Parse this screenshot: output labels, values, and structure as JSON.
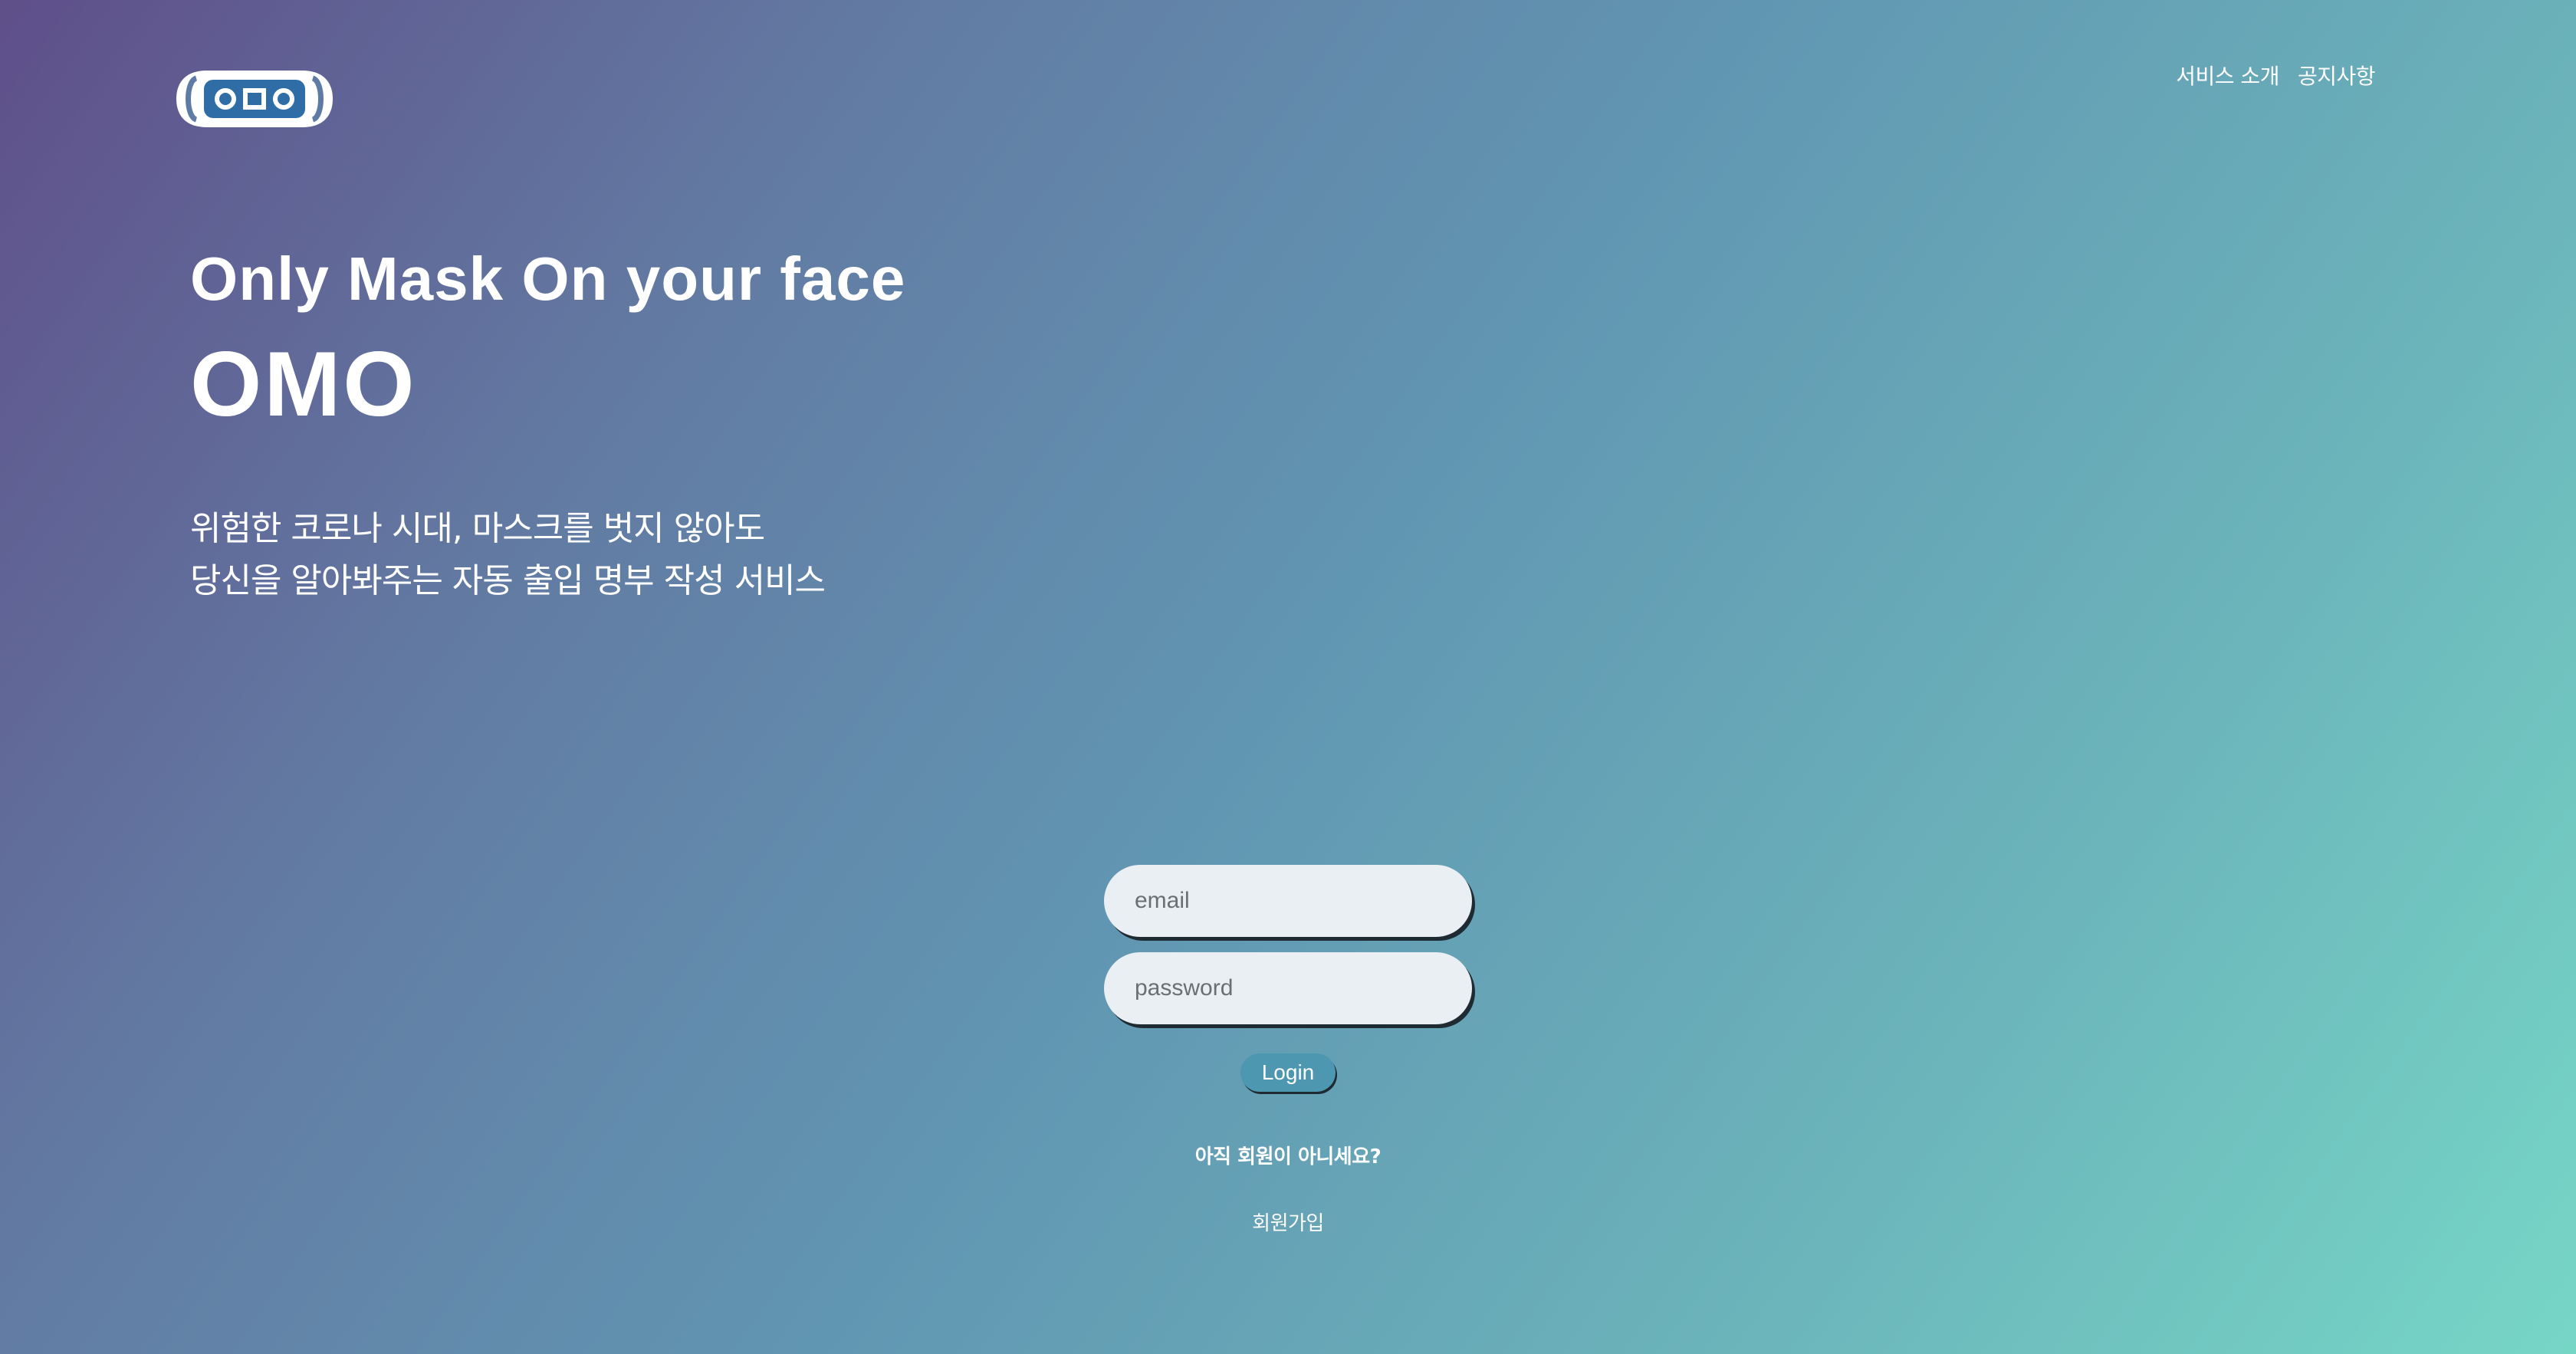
{
  "header": {
    "logo_icon": "omo-mask-logo",
    "nav": [
      {
        "label": "서비스 소개"
      },
      {
        "label": "공지사항"
      }
    ]
  },
  "hero": {
    "tagline": "Only Mask On your face",
    "brand": "OMO",
    "description_line1": "위험한 코로나 시대, 마스크를 벗지 않아도",
    "description_line2": "당신을 알아봐주는 자동 출입 명부 작성 서비스"
  },
  "login": {
    "email_placeholder": "email",
    "password_placeholder": "password",
    "button_label": "Login",
    "signup_question": "아직 회원이 아니세요?",
    "signup_link": "회원가입"
  },
  "colors": {
    "gradient_start": "#5f4f8a",
    "gradient_end": "#76d6c6",
    "logo_shape": "#2f6da6",
    "button": "#4e97b0"
  }
}
